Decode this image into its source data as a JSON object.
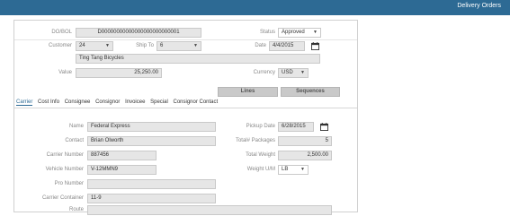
{
  "header": {
    "title": "Delivery Orders"
  },
  "top": {
    "dobol_label": "DO/BOL",
    "dobol_value": "D00000000000000000000000001",
    "status_label": "Status",
    "status_value": "Approved",
    "customer_label": "Customer",
    "customer_value": "24",
    "shipto_label": "Ship To",
    "shipto_value": "6",
    "date_label": "Date",
    "date_value": "4/4/2015",
    "customer_name": "Ting Tang Bicycles",
    "value_label": "Value",
    "value_value": "25,250.00",
    "currency_label": "Currency",
    "currency_value": "USD"
  },
  "buttons": {
    "lines": "Lines",
    "sequences": "Sequences"
  },
  "tabs": [
    "Carrier",
    "Cost Info",
    "Consignee",
    "Consignor",
    "Invoicee",
    "Special",
    "Consignor Contact"
  ],
  "carrier": {
    "name_label": "Name",
    "name_value": "Federal Express",
    "pickup_label": "Pickup Date",
    "pickup_value": "6/28/2015",
    "contact_label": "Contact",
    "contact_value": "Brian Olworth",
    "packages_label": "Total# Packages",
    "packages_value": "5",
    "carrier_number_label": "Carrier Number",
    "carrier_number_value": "887456",
    "total_weight_label": "Total Weight",
    "total_weight_value": "2,500.00",
    "vehicle_number_label": "Vehicle Number",
    "vehicle_number_value": "V-12MMN9",
    "weight_um_label": "Weight U/M",
    "weight_um_value": "LB",
    "pro_number_label": "Pro Number",
    "pro_number_value": "",
    "carrier_container_label": "Carrier Container",
    "carrier_container_value": "11-9",
    "route_label": "Route",
    "route_value": ""
  },
  "colors": {
    "accent": "#2d6a94",
    "field_bg": "#e6e6e6"
  },
  "icons": {
    "calendar": "calendar-icon",
    "dropdown": "chevron-down-icon"
  }
}
